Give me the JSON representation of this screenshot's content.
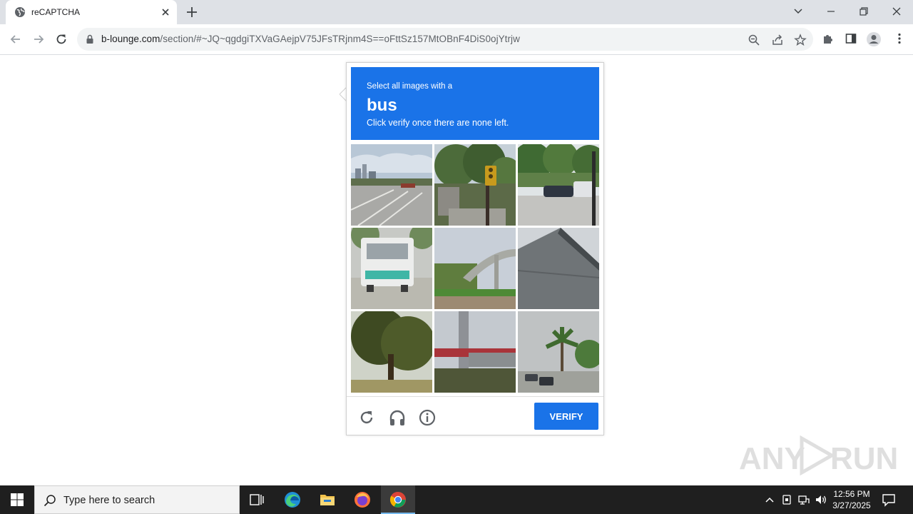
{
  "browser": {
    "tab_title": "reCAPTCHA",
    "url_host": "b-lounge.com",
    "url_path": "/section/#~JQ~qgdgiTXVaGAejpV75JFsTRjnm4S==oFttSz157MtOBnF4DiS0ojYtrjw"
  },
  "captcha": {
    "instruction_line1": "Select all images with a",
    "target_object": "bus",
    "instruction_line2": "Click verify once there are none left.",
    "tiles": [
      {
        "name": "tile-1-road-city"
      },
      {
        "name": "tile-2-traffic-light"
      },
      {
        "name": "tile-3-parked-cars"
      },
      {
        "name": "tile-4-bus-rear"
      },
      {
        "name": "tile-5-overpass"
      },
      {
        "name": "tile-6-roof-wall"
      },
      {
        "name": "tile-7-tree"
      },
      {
        "name": "tile-8-bridge-pillar"
      },
      {
        "name": "tile-9-palm-street"
      }
    ],
    "verify_label": "VERIFY",
    "accent_color": "#1a73e8"
  },
  "watermark": {
    "text_left": "ANY",
    "text_right": "RUN"
  },
  "taskbar": {
    "search_placeholder": "Type here to search",
    "time": "12:56 PM",
    "date": "3/27/2025"
  }
}
